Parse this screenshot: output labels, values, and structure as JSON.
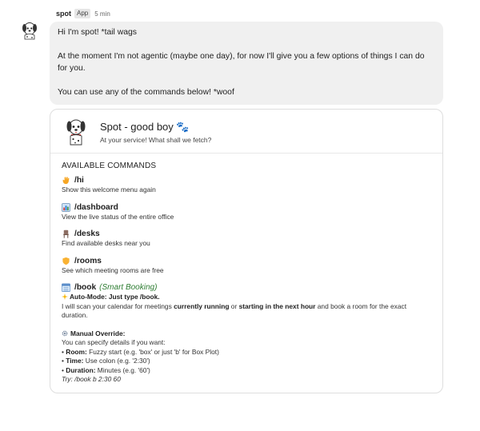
{
  "message": {
    "sender": "spot",
    "badge": "App",
    "time": "5 min",
    "lines": [
      "Hi I'm spot! *tail wags",
      "At the moment I'm not agentic (maybe one day), for now I'll give you a few options of things I can do for you.",
      "You can use any of the commands below! *woof"
    ]
  },
  "card": {
    "title": "Spot - good boy 🐾",
    "subtitle": "At your service! What shall we fetch?",
    "section_title": "AVAILABLE COMMANDS",
    "commands": [
      {
        "icon": "wave-hand-icon",
        "name": "/hi",
        "desc": "Show this welcome menu again"
      },
      {
        "icon": "chart-icon",
        "name": "/dashboard",
        "desc": "View the live status of the entire office"
      },
      {
        "icon": "chair-icon",
        "name": "/desks",
        "desc": "Find available desks near you"
      },
      {
        "icon": "shield-icon",
        "name": "/rooms",
        "desc": "See which meeting rooms are free"
      }
    ],
    "book": {
      "icon": "calendar-icon",
      "name": "/book",
      "note": "(Smart Booking)",
      "auto_label": "Auto-Mode:",
      "auto_text": " Just type /book.",
      "scan_1": "I will scan your calendar for meetings ",
      "scan_bold_1": "currently running",
      "scan_2": " or ",
      "scan_bold_2": "starting in the next hour",
      "scan_3": " and book a room for the exact duration.",
      "manual_label": "Manual Override:",
      "manual_intro": "You can specify details if you want:",
      "room_label": "Room:",
      "room_text": " Fuzzy start (e.g. 'box' or just 'b' for Box Plot)",
      "time_label": "Time:",
      "time_text": " Use colon (e.g. '2:30')",
      "duration_label": "Duration:",
      "duration_text": " Minutes (e.g. '60')",
      "try_text": "Try: /book b 2:30 60"
    }
  },
  "colors": {
    "bubble": "#f0f0f0",
    "accent_green": "#2e7d32",
    "border": "#dedede"
  }
}
